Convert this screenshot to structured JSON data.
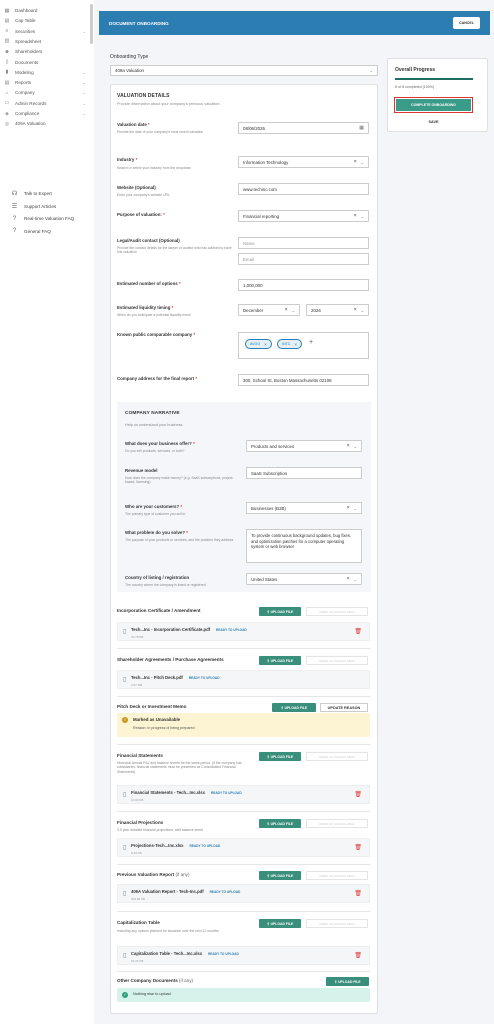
{
  "sidebar": {
    "items": [
      {
        "label": "Dashboard",
        "icon": "grid-icon",
        "chev": ""
      },
      {
        "label": "Cap Table",
        "icon": "table-icon",
        "chev": ""
      },
      {
        "label": "Securities",
        "icon": "layers-icon",
        "chev": "⌄"
      },
      {
        "label": "Spreadsheet",
        "icon": "spreadsheet-icon",
        "chev": ""
      },
      {
        "label": "Shareholders",
        "icon": "users-icon",
        "chev": ""
      },
      {
        "label": "Documents",
        "icon": "document-icon",
        "chev": ""
      },
      {
        "label": "Modeling",
        "icon": "chart-icon",
        "chev": "⌄"
      },
      {
        "label": "Reports",
        "icon": "report-icon",
        "chev": "⌄"
      },
      {
        "label": "Company",
        "icon": "building-icon",
        "chev": "⌄"
      },
      {
        "label": "Admin Records",
        "icon": "folder-icon",
        "chev": "⌄"
      },
      {
        "label": "Compliance",
        "icon": "shield-icon",
        "chev": "⌄"
      },
      {
        "label": "409A Valuation",
        "icon": "valuation-icon",
        "chev": ""
      }
    ],
    "help": [
      {
        "label": "Talk to Expert",
        "icon": "headset-icon"
      },
      {
        "label": "Support Articles",
        "icon": "article-icon"
      },
      {
        "label": "Real-time Valuation FAQ",
        "icon": "question-icon"
      },
      {
        "label": "General FAQ",
        "icon": "question-icon"
      }
    ]
  },
  "header": {
    "title": "DOCUMENT ONBOARDING",
    "cancel": "CANCEL"
  },
  "onboarding_type": {
    "label": "Onboarding Type",
    "value": "409a Valuation"
  },
  "progress": {
    "title": "Overall Progress",
    "fraction": 1.0,
    "text": "8 of 8 completed (100%)",
    "complete": "COMPLETE ONBOARDING",
    "save": "SAVE"
  },
  "valuation": {
    "title": "VALUATION DETAILS",
    "subtitle": "Provide information about your company's previous valuation.",
    "date": {
      "label": "Valuation date",
      "desc": "Provide the date of your company's most recent valuation",
      "value": "08/06/2026"
    },
    "industry": {
      "label": "Industry",
      "desc": "Search or select your industry from the dropdown",
      "value": "Information Technology"
    },
    "website": {
      "label": "Website (Optional)",
      "desc": "Enter your company's website URL",
      "value": "www.techinc.com"
    },
    "purpose": {
      "label": "Purpose of valuation:",
      "value": "Financial reporting"
    },
    "legal": {
      "label": "Legal/Audit contact (Optional)",
      "desc": "Provide the contact details for the lawyer or auditor who has advised to have this valuation",
      "name_ph": "Name",
      "email_ph": "Email"
    },
    "options": {
      "label": "Estimated number of options",
      "value": "1,000,000"
    },
    "liquidity": {
      "label": "Estimated liquidity timing",
      "desc": "When do you anticipate a potential liquidity event",
      "month": "December",
      "year": "2026"
    },
    "comparables": {
      "label": "Known public comparable company",
      "tags": [
        "AVGO",
        "INTC"
      ]
    },
    "address": {
      "label": "Company address for the final report",
      "value": "300, School St, Boston Massachusetts 02108"
    }
  },
  "narrative": {
    "title": "COMPANY NARRATIVE",
    "subtitle": "Help us understand your business.",
    "offer": {
      "label": "What does your business offer?",
      "desc": "Do you sell products, services, or both?",
      "value": "Products and services"
    },
    "revenue": {
      "label": "Revenue model",
      "desc": "How does the company make money? (e.g. SaaS subscriptions, project-based, licensing)",
      "value": "SaaS Subscription"
    },
    "customers": {
      "label": "Who are your customers?",
      "desc": "The primary type of customer you sell to",
      "value": "Businesses (B2B)"
    },
    "problem": {
      "label": "What problem do you solve?",
      "desc": "The purpose of your products or services, and the problem they address",
      "value": "To provide continuous background updates, bug fixes, and optimization patches for a computer operating system or web browser"
    },
    "country": {
      "label": "Country of listing / registration",
      "desc": "The country where the company is listed or registered",
      "value": "United States"
    }
  },
  "documents": {
    "upload": "UPLOAD FILE",
    "unavailable": "MARK AS UNAVAILABLE",
    "update_reason": "UPDATE REASON",
    "ready": "READY TO UPLOAD",
    "incorporation": {
      "title": "Incorporation Certificate / Amendment",
      "file": "Tech...Inc - Incorporation Certificate.pdf",
      "size": "70.78 KB"
    },
    "shareholder": {
      "title": "Shareholder Agreements / Purchase Agreements",
      "file": "Tech...Inc - Pitch Deck.pdf",
      "size": "2.57 MB"
    },
    "pitch": {
      "title": "Pitch Deck or Investment Memo",
      "warn_title": "Marked as Unavailable",
      "warn_reason": "Reason: In progress of being prepared"
    },
    "financials": {
      "title": "Financial Statements",
      "desc": "Historical Annual P&L and balance sheets for the same period. (If the company has subsidiaries, financial statements must be presented as Consolidated Financial Statements)",
      "file": "Financial Statements - Tech...Inc.xlsx",
      "size": "10.60 KB"
    },
    "projections": {
      "title": "Financial Projections",
      "desc": "3-5 year detailed financial projections, with balance sheet",
      "file": "Projections-Tech...Inc.xlsx",
      "size": "9.43 KB"
    },
    "previous": {
      "title": "Previous Valuation Report",
      "optional": "(if any)",
      "file": "409A Valuation Report - Tech-Inc.pdf",
      "size": "304.80 KB"
    },
    "captables": {
      "title": "Capitalization Table",
      "desc": "Including any options planned for issuance over the next 12 months.",
      "file": "Capitalization Table - Tech...Inc.xlsx",
      "size": "22.37 KB"
    },
    "other": {
      "title": "Other Company Documents",
      "optional": "(if any)",
      "nothing": "Nothing else to upload"
    }
  }
}
